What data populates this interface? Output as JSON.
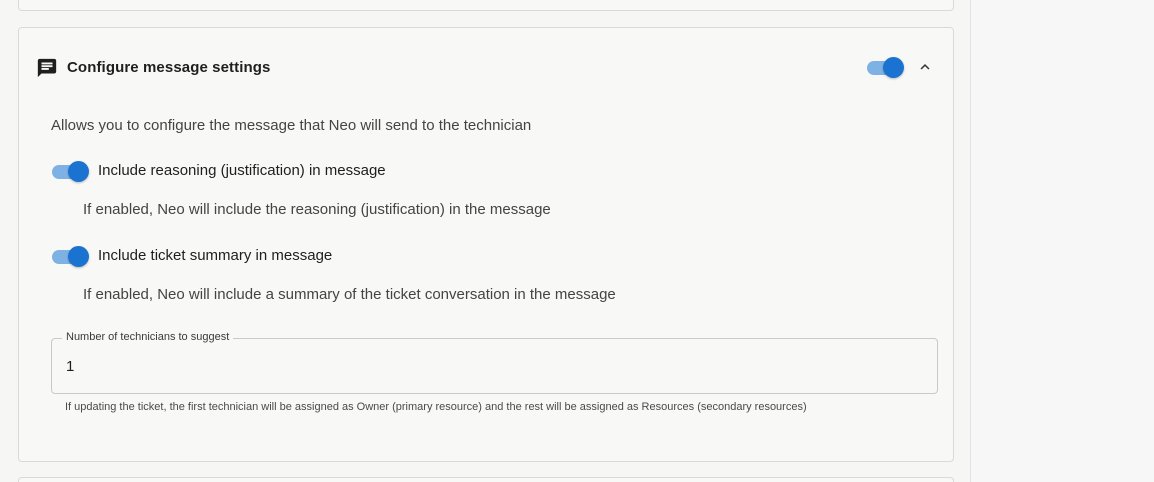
{
  "section": {
    "title": "Configure message settings",
    "icon": "message-icon",
    "enabled": true,
    "expanded": true,
    "description": "Allows you to configure the message that Neo will send to the technician"
  },
  "options": [
    {
      "label": "Include reasoning (justification) in message",
      "enabled": true,
      "help": "If enabled, Neo will include the reasoning (justification) in the message"
    },
    {
      "label": "Include ticket summary in message",
      "enabled": true,
      "help": "If enabled, Neo will include a summary of the ticket conversation in the message"
    }
  ],
  "technicians_field": {
    "label": "Number of technicians to suggest",
    "value": "1",
    "helper": "If updating the ticket, the first technician will be assigned as Owner (primary resource) and the rest will be assigned as Resources (secondary resources)"
  },
  "colors": {
    "toggle_thumb": "#1a73d1",
    "toggle_track": "#7fb2e4"
  }
}
